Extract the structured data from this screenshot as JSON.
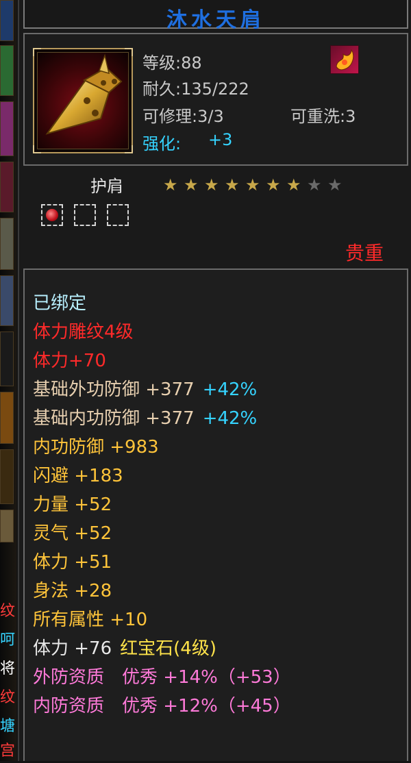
{
  "item": {
    "title": "沐水天肩",
    "level": "等级:88",
    "durability": "耐久:135/222",
    "repair": "可修理:3/3",
    "rewash": "可重洗:3",
    "enhance_label": "强化:",
    "enhance_value": "+3",
    "part": "护肩",
    "star_rating": {
      "filled": 7,
      "total": 9
    },
    "gem_slots": {
      "filled": 1,
      "total": 3
    },
    "rarity": "贵重"
  },
  "colors": {
    "title": "#1f6fe0",
    "bound": "#b8f0ff",
    "red": "#ff2a2a",
    "base": "#e8d0b0",
    "cyan": "#35d3ff",
    "yellow": "#ffc43a",
    "pink": "#ff7ad9",
    "rarity": "#ff2a2a",
    "star_on": "#c8a84a",
    "star_off": "#6a6a6a"
  },
  "attributes": [
    {
      "text": "已绑定",
      "color": "#b8f0ff"
    },
    {
      "text": "体力雕纹4级",
      "color": "#ff2a2a"
    },
    {
      "text": "体力+70",
      "color": "#ff2a2a"
    },
    {
      "parts": [
        {
          "text": "基础外功防御 +377",
          "color": "#e8d0b0"
        },
        {
          "text": "+42%",
          "color": "#35d3ff"
        }
      ]
    },
    {
      "parts": [
        {
          "text": "基础内功防御 +377",
          "color": "#e8d0b0"
        },
        {
          "text": "+42%",
          "color": "#35d3ff"
        }
      ]
    },
    {
      "text": "内功防御 +983",
      "color": "#ffc43a"
    },
    {
      "text": "闪避 +183",
      "color": "#ffc43a"
    },
    {
      "text": "力量 +52",
      "color": "#ffc43a"
    },
    {
      "text": "灵气 +52",
      "color": "#ffc43a"
    },
    {
      "text": "体力 +51",
      "color": "#ffc43a"
    },
    {
      "text": "身法 +28",
      "color": "#ffc43a"
    },
    {
      "text": "所有属性 +10",
      "color": "#ffc43a"
    },
    {
      "parts": [
        {
          "text": "体力 +76",
          "color": "#e8e8e8"
        },
        {
          "text": "红宝石(4级)",
          "color": "#ffe34a"
        }
      ]
    },
    {
      "text": "外防资质　优秀 +14%（+53）",
      "color": "#ff7ad9"
    },
    {
      "text": "内防资质　优秀 +12%（+45）",
      "color": "#ff7ad9"
    }
  ],
  "left_strip_chars": [
    {
      "text": "纹",
      "color": "#ff3b3b"
    },
    {
      "text": "呵",
      "color": "#35d3ff"
    },
    {
      "text": "将",
      "color": "#ffffff"
    },
    {
      "text": "纹",
      "color": "#ff3b3b"
    },
    {
      "text": "塘",
      "color": "#35d3ff"
    },
    {
      "text": "宫",
      "color": "#ff3b3b"
    }
  ]
}
